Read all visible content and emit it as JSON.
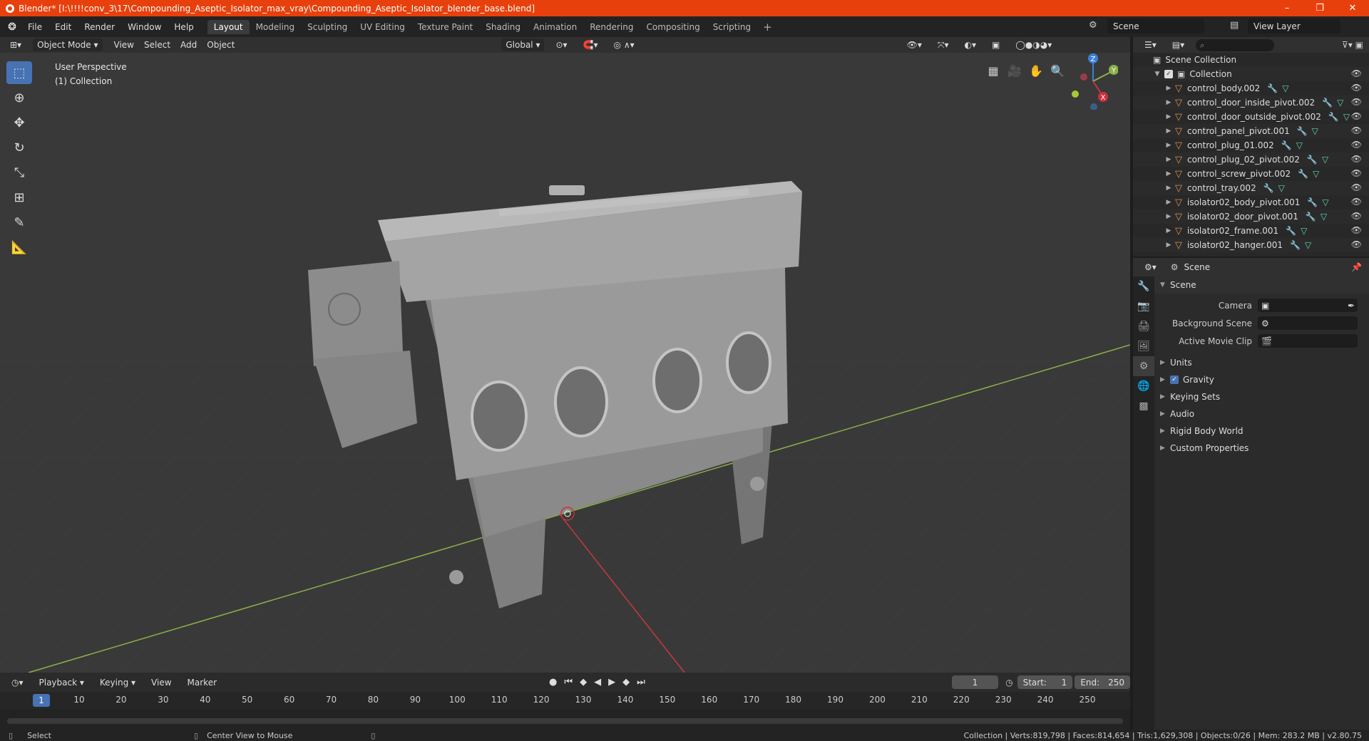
{
  "title_bar": {
    "title": "Blender* [I:\\!!!!conv_3\\17\\Compounding_Aseptic_Isolator_max_vray\\Compounding_Aseptic_Isolator_blender_base.blend]",
    "minimize": "–",
    "maximize": "❐",
    "close": "✕"
  },
  "menu": [
    "File",
    "Edit",
    "Render",
    "Window",
    "Help"
  ],
  "workspaces": [
    "Layout",
    "Modeling",
    "Sculpting",
    "UV Editing",
    "Texture Paint",
    "Shading",
    "Animation",
    "Rendering",
    "Compositing",
    "Scripting"
  ],
  "scene_name": "Scene",
  "view_layer": "View Layer",
  "viewport_header": {
    "mode": "Object Mode",
    "view": "View",
    "select": "Select",
    "add": "Add",
    "object": "Object",
    "orientation": "Global"
  },
  "viewport_info": {
    "perspective": "User Perspective",
    "collection": "(1) Collection"
  },
  "gizmo": {
    "z": "Z",
    "y": "Y",
    "x": "X"
  },
  "outliner": {
    "root": "Scene Collection",
    "collection": "Collection",
    "items": [
      "control_body.002",
      "control_door_inside_pivot.002",
      "control_door_outside_pivot.002",
      "control_panel_pivot.001",
      "control_plug_01.002",
      "control_plug_02_pivot.002",
      "control_screw_pivot.002",
      "control_tray.002",
      "isolator02_body_pivot.001",
      "isolator02_door_pivot.001",
      "isolator02_frame.001",
      "isolator02_hanger.001"
    ]
  },
  "properties": {
    "context": "Scene",
    "panel": "Scene",
    "camera_label": "Camera",
    "background_label": "Background Scene",
    "clip_label": "Active Movie Clip",
    "subpanels": [
      "Units",
      "Gravity",
      "Keying Sets",
      "Audio",
      "Rigid Body World",
      "Custom Properties"
    ]
  },
  "timeline": {
    "playback": "Playback",
    "keying": "Keying",
    "view": "View",
    "marker": "Marker",
    "current_frame": "1",
    "start_label": "Start:",
    "start": "1",
    "end_label": "End:",
    "end": "250",
    "ruler": [
      "10",
      "20",
      "30",
      "40",
      "50",
      "60",
      "70",
      "80",
      "90",
      "100",
      "110",
      "120",
      "130",
      "140",
      "150",
      "160",
      "170",
      "180",
      "190",
      "200",
      "210",
      "220",
      "230",
      "240",
      "250"
    ]
  },
  "status": {
    "left": "Select",
    "middle": "Center View to Mouse",
    "right": "Collection | Verts:819,798 | Faces:814,654 | Tris:1,629,308 | Objects:0/26 | Mem: 283.2 MB | v2.80.75"
  }
}
